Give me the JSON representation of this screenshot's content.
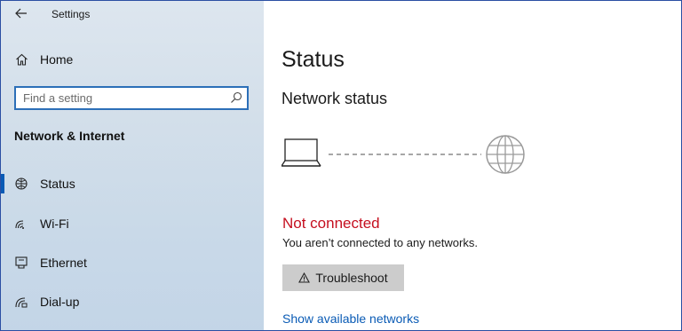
{
  "window": {
    "title": "Settings"
  },
  "sidebar": {
    "home_label": "Home",
    "search": {
      "placeholder": "Find a setting",
      "value": ""
    },
    "section_title": "Network & Internet",
    "items": [
      {
        "label": "Status",
        "icon": "status-icon",
        "active": true
      },
      {
        "label": "Wi-Fi",
        "icon": "wifi-icon",
        "active": false
      },
      {
        "label": "Ethernet",
        "icon": "ethernet-icon",
        "active": false
      },
      {
        "label": "Dial-up",
        "icon": "dialup-icon",
        "active": false
      }
    ]
  },
  "main": {
    "title": "Status",
    "subtitle": "Network status",
    "connection_status": "Not connected",
    "connection_description": "You aren’t connected to any networks.",
    "troubleshoot_label": "Troubleshoot",
    "show_networks_label": "Show available networks"
  },
  "colors": {
    "accent": "#0a5bb5",
    "error": "#c50f1f",
    "button_bg": "#cccccc",
    "sidebar_bg": "#d3dfea"
  }
}
